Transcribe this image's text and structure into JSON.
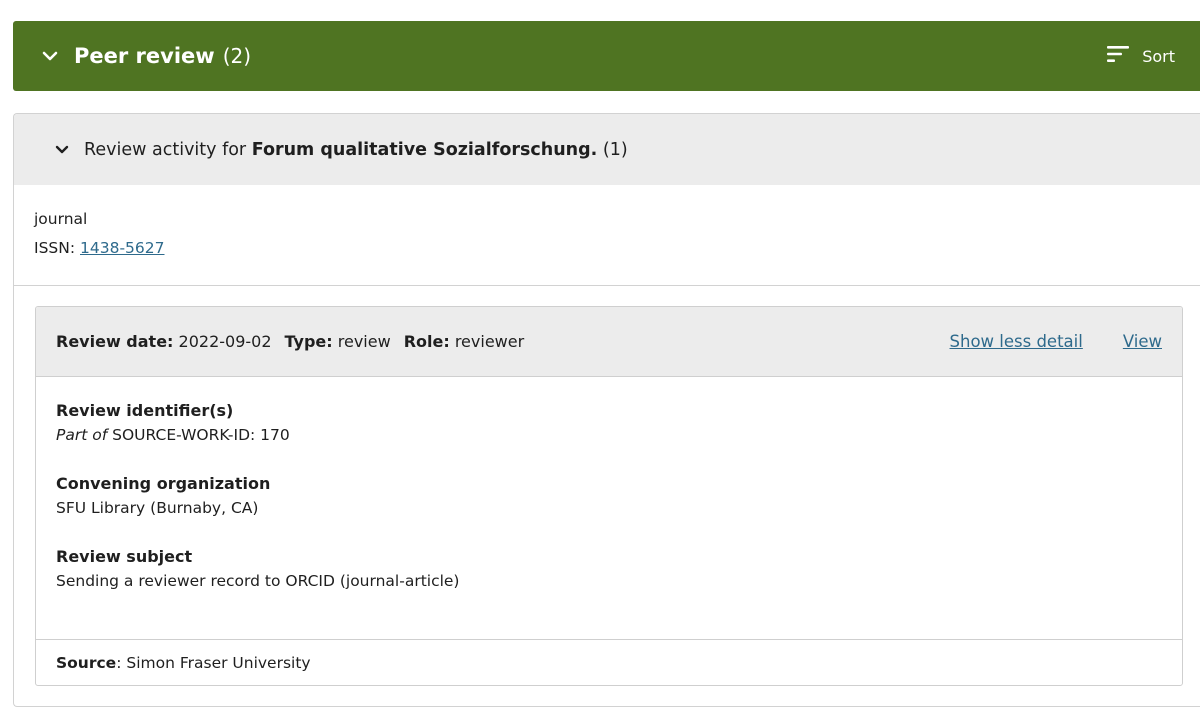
{
  "section": {
    "title": "Peer review",
    "count": "(2)",
    "sort_label": "Sort"
  },
  "group": {
    "prefix": "Review activity for ",
    "journal_name": "Forum qualitative Sozialforschung.",
    "count": "(1)",
    "type": "journal",
    "issn_label": "ISSN: ",
    "issn_value": "1438-5627"
  },
  "review": {
    "date_label": "Review date:",
    "date_value": "2022-09-02",
    "type_label": "Type:",
    "type_value": "review",
    "role_label": "Role:",
    "role_value": "reviewer",
    "show_less_label": "Show less detail",
    "view_label": "View",
    "identifier_label": "Review identifier(s)",
    "identifier_part_of": "Part of",
    "identifier_value": "SOURCE-WORK-ID: 170",
    "org_label": "Convening organization",
    "org_value": "SFU Library (Burnaby, CA)",
    "subject_label": "Review subject",
    "subject_value": "Sending a reviewer record to ORCID (journal-article)",
    "source_label": "Source",
    "source_value": "Simon Fraser University"
  },
  "colors": {
    "header_green": "#4f7422",
    "link_blue": "#2e6a8c",
    "panel_gray": "#ececec"
  },
  "icons": {
    "section_toggle": "chevron-down-icon",
    "sort": "sort-icon",
    "group_toggle": "chevron-down-icon"
  }
}
